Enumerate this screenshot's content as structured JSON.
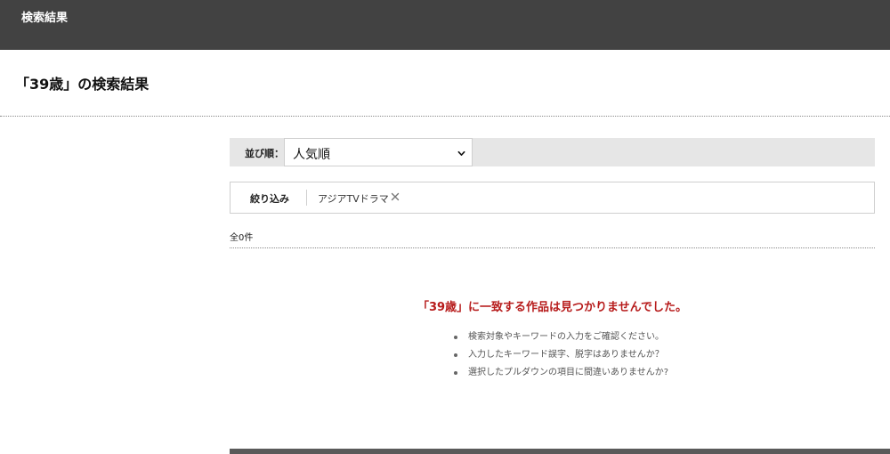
{
  "header": {
    "title": "検索結果"
  },
  "page": {
    "heading": "「39歳」の検索結果"
  },
  "sort": {
    "label": "並び順：",
    "selected": "人気順"
  },
  "filter": {
    "label": "絞り込み",
    "chips": [
      {
        "label": "アジアTVドラマ"
      }
    ]
  },
  "results": {
    "count_text": "全0件",
    "no_result_message": "「39歳」に一致する作品は見つかりませんでした。",
    "hints": [
      "検索対象やキーワードの入力をご確認ください。",
      "入力したキーワード誤字、脱字はありませんか？",
      "選択したプルダウンの項目に間違いありませんか?"
    ]
  },
  "colors": {
    "header_bg": "#424242",
    "error_text": "#b71c1c",
    "sort_bar_bg": "#e6e6e6"
  },
  "icons": {
    "sort_select": "chevron-down-icon",
    "chip_remove": "close-icon",
    "hint_bullet": "bullet-icon"
  }
}
